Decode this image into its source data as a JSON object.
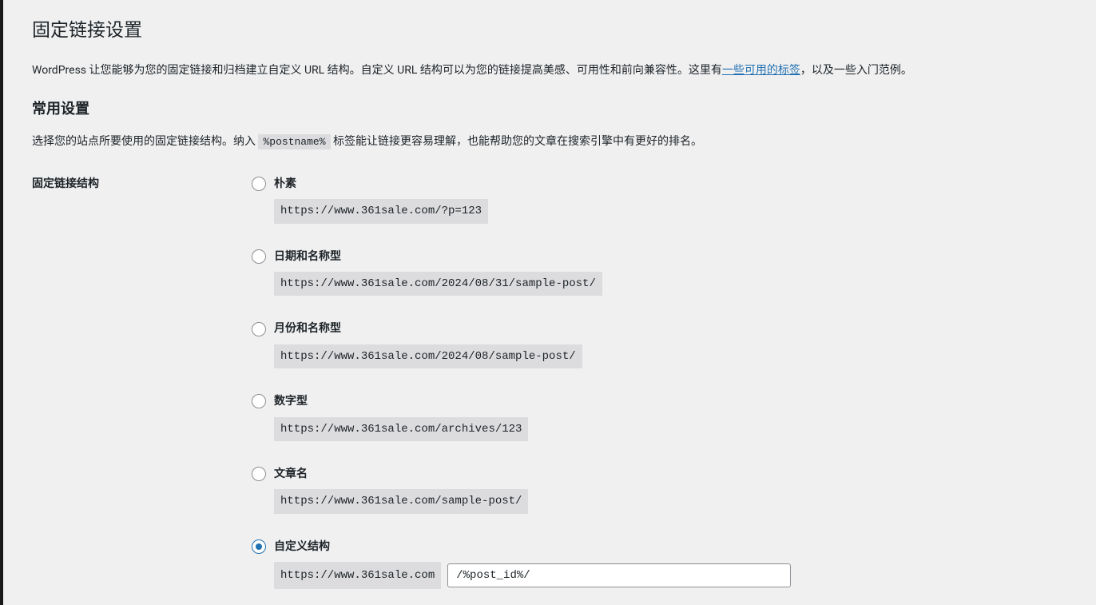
{
  "page_title": "固定链接设置",
  "intro": {
    "pre": "WordPress 让您能够为您的固定链接和归档建立自定义 URL 结构。自定义 URL 结构可以为您的链接提高美感、可用性和前向兼容性。这里有",
    "link_text": "一些可用的标签",
    "post": "，以及一些入门范例。"
  },
  "section_heading": "常用设置",
  "section_desc": {
    "pre": "选择您的站点所要使用的固定链接结构。纳入 ",
    "code": "%postname%",
    "post": " 标签能让链接更容易理解，也能帮助您的文章在搜索引擎中有更好的排名。"
  },
  "form_label": "固定链接结构",
  "options": [
    {
      "id": "plain",
      "label": "朴素",
      "example": "https://www.361sale.com/?p=123",
      "checked": false
    },
    {
      "id": "day_name",
      "label": "日期和名称型",
      "example": "https://www.361sale.com/2024/08/31/sample-post/",
      "checked": false
    },
    {
      "id": "month_name",
      "label": "月份和名称型",
      "example": "https://www.361sale.com/2024/08/sample-post/",
      "checked": false
    },
    {
      "id": "numeric",
      "label": "数字型",
      "example": "https://www.361sale.com/archives/123",
      "checked": false
    },
    {
      "id": "post_name",
      "label": "文章名",
      "example": "https://www.361sale.com/sample-post/",
      "checked": false
    }
  ],
  "custom": {
    "id": "custom",
    "label": "自定义结构",
    "prefix": "https://www.361sale.com",
    "value": "/%post_id%/",
    "checked": true
  }
}
